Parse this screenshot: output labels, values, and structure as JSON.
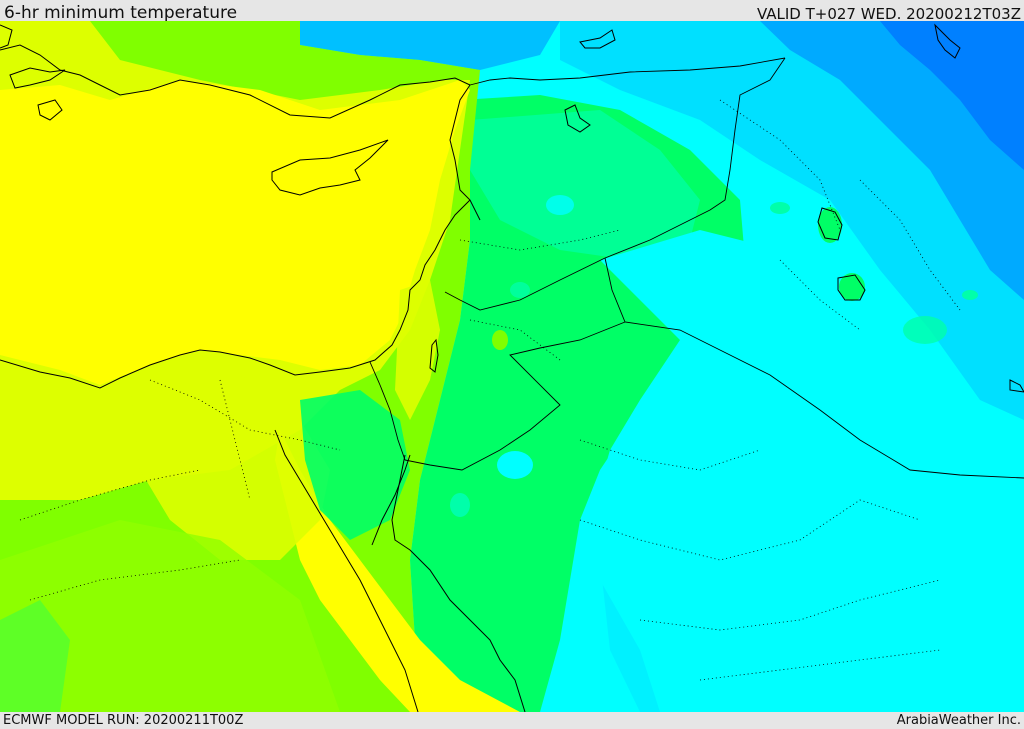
{
  "header": {
    "title": "6-hr minimum temperature",
    "valid": "VALID T+027 WED. 20200212T03Z"
  },
  "footer": {
    "model_run": "ECMWF MODEL RUN: 20200211T00Z",
    "credit": "ArabiaWeather Inc."
  },
  "colors": {
    "yellow": "#ffff00",
    "yellow_green": "#ddff00",
    "lime": "#80ff00",
    "green": "#00ff66",
    "aqua_green": "#00ffaa",
    "cyan": "#00ffff",
    "light_blue": "#00e0ff",
    "blue": "#00aaff",
    "deep_blue": "#0080ff"
  }
}
